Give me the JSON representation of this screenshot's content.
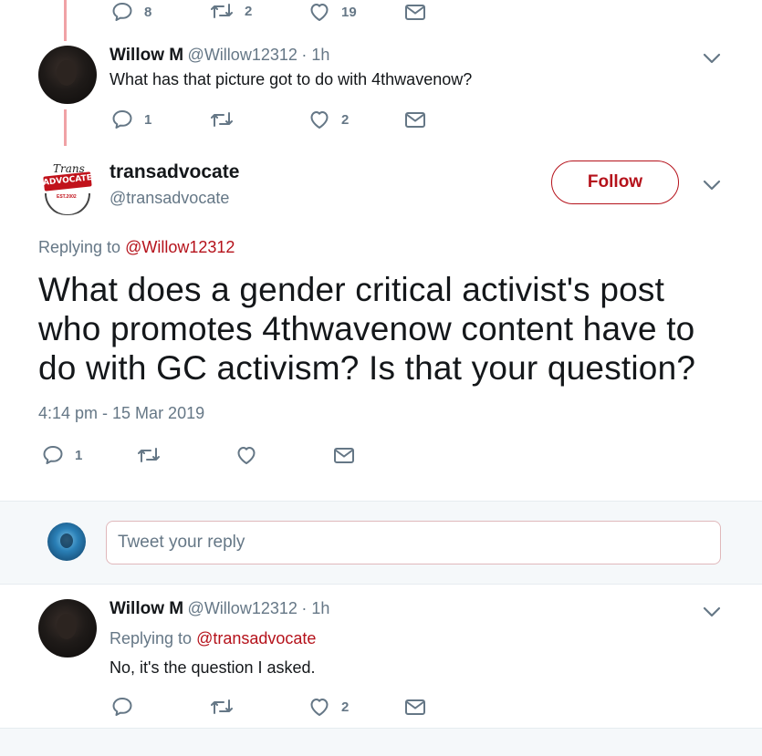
{
  "tweet_top": {
    "reply_count": "8",
    "retweet_count": "2",
    "like_count": "19"
  },
  "reply1": {
    "name": "Willow M",
    "handle": "@Willow12312",
    "time": "· 1h",
    "text": "What has that picture got to do with 4thwavenow?",
    "reply_count": "1",
    "like_count": "2"
  },
  "main_tweet": {
    "name": "transadvocate",
    "handle": "@transadvocate",
    "follow_label": "Follow",
    "replying_prefix": "Replying to",
    "replying_to": "@Willow12312",
    "text": "What does a gender critical activist's post who promotes 4thwavenow content have to do with GC activism? Is that your question?",
    "timestamp": "4:14 pm - 15 Mar 2019",
    "reply_count": "1",
    "logo_text": {
      "top": "Trans",
      "middle": "ADVOCATE",
      "bottom": "EST.2002"
    }
  },
  "composer": {
    "placeholder": "Tweet your reply"
  },
  "reply2": {
    "name": "Willow M",
    "handle": "@Willow12312",
    "time": "· 1h",
    "replying_prefix": "Replying to",
    "replying_to": "@transadvocate",
    "text": "No, it's the question I asked.",
    "like_count": "2"
  },
  "colors": {
    "accent": "#b5121b",
    "muted": "#657786",
    "thread_line": "#f0a2a6"
  },
  "icons": [
    "comment-icon",
    "retweet-icon",
    "like-icon",
    "message-icon",
    "chevron-down-icon"
  ]
}
